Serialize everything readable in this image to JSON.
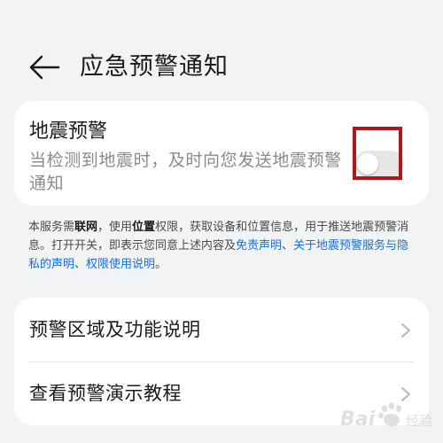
{
  "header": {
    "title": "应急预警通知",
    "back_icon": "arrow-left-icon"
  },
  "earthquake": {
    "title": "地震预警",
    "description": "当检测到地震时，及时向您发送地震预警通知",
    "toggle_on": false
  },
  "notice": {
    "p1": "本服务需",
    "b1": "联网",
    "p2": "，使用",
    "b2": "位置",
    "p3": "权限，获取设备和位置信息，用于推送地震预警消息。打开开关，即表示您同意上述内容及",
    "link1": "免责声明",
    "p4": "、",
    "link2": "关于地震预警服务与隐私的声明",
    "p5": "、",
    "link3": "权限使用说明",
    "p6": "。"
  },
  "menu": {
    "items": [
      {
        "label": "预警区域及功能说明",
        "icon": "chevron-right-icon"
      },
      {
        "label": "查看预警演示教程",
        "icon": "chevron-right-icon"
      }
    ]
  },
  "watermark": {
    "text": "Baidu经验",
    "brand": "Bai"
  },
  "colors": {
    "background": "#f1f3f5",
    "card": "#ffffff",
    "link": "#1a6ee0",
    "highlight_box": "#b01818",
    "toggle_off": "#e4e6e8"
  }
}
